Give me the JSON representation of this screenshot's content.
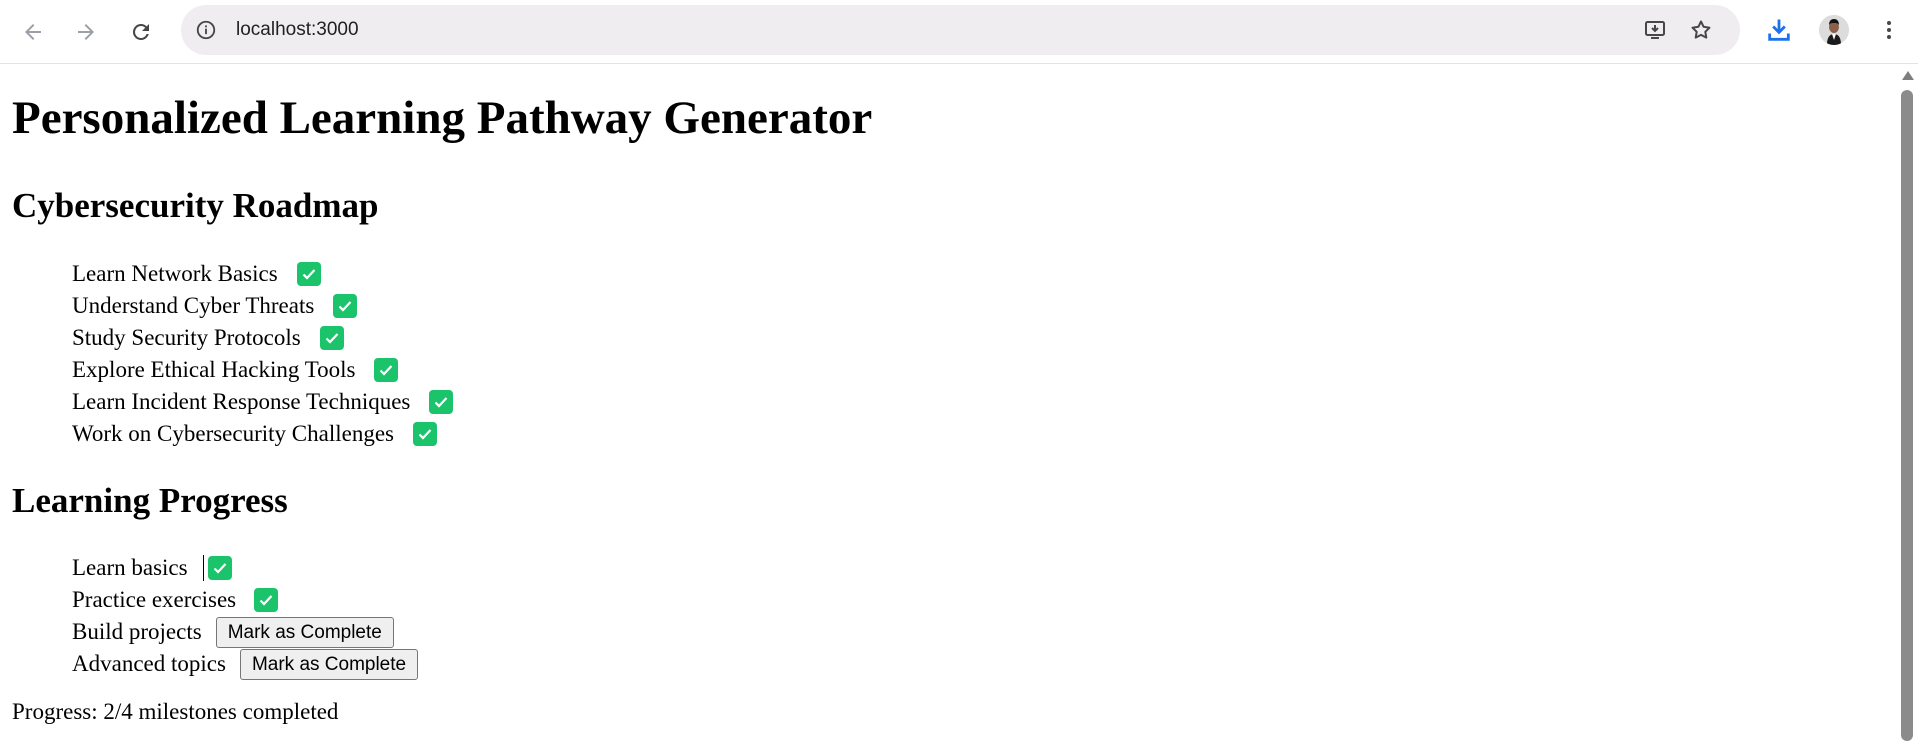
{
  "browser": {
    "url": "localhost:3000",
    "icons": {
      "back": "arrow-left-icon",
      "forward": "arrow-right-icon",
      "reload": "reload-icon",
      "site_info": "info-icon",
      "install_app": "install-app-icon",
      "bookmark": "star-icon",
      "downloads": "download-icon",
      "menu": "kebab-menu-icon"
    },
    "accent_color": "#1a73e8"
  },
  "page": {
    "title": "Personalized Learning Pathway Generator",
    "roadmap": {
      "heading": "Cybersecurity Roadmap",
      "items": [
        {
          "label": "Learn Network Basics",
          "completed": true
        },
        {
          "label": "Understand Cyber Threats",
          "completed": true
        },
        {
          "label": "Study Security Protocols",
          "completed": true
        },
        {
          "label": "Explore Ethical Hacking Tools",
          "completed": true
        },
        {
          "label": "Learn Incident Response Techniques",
          "completed": true
        },
        {
          "label": "Work on Cybersecurity Challenges",
          "completed": true
        }
      ]
    },
    "progress": {
      "heading": "Learning Progress",
      "items": [
        {
          "label": "Learn basics",
          "completed": true
        },
        {
          "label": "Practice exercises",
          "completed": true
        },
        {
          "label": "Build projects",
          "completed": false,
          "button_label": "Mark as Complete"
        },
        {
          "label": "Advanced topics",
          "completed": false,
          "button_label": "Mark as Complete"
        }
      ],
      "summary": "Progress: 2/4 milestones completed"
    },
    "check_color": "#1bc46a"
  }
}
